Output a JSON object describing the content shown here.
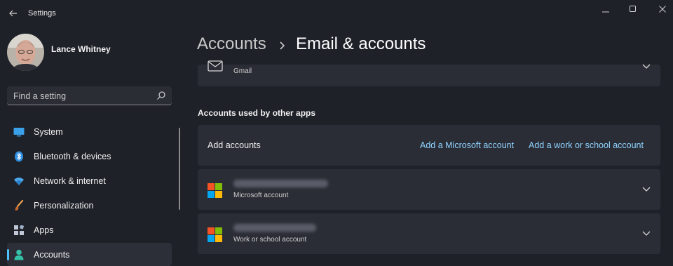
{
  "window": {
    "title": "Settings"
  },
  "user": {
    "name": "Lance Whitney"
  },
  "search": {
    "placeholder": "Find a setting"
  },
  "sidebar": {
    "items": [
      {
        "label": "System",
        "icon": "system-icon",
        "active": false
      },
      {
        "label": "Bluetooth & devices",
        "icon": "bluetooth-icon",
        "active": false
      },
      {
        "label": "Network & internet",
        "icon": "wifi-icon",
        "active": false
      },
      {
        "label": "Personalization",
        "icon": "paintbrush-icon",
        "active": false
      },
      {
        "label": "Apps",
        "icon": "apps-icon",
        "active": false
      },
      {
        "label": "Accounts",
        "icon": "accounts-icon",
        "active": true
      }
    ]
  },
  "header": {
    "parent": "Accounts",
    "separator": "›",
    "title": "Email & accounts"
  },
  "email_card": {
    "subtitle": "Gmail"
  },
  "section": {
    "other_apps_header": "Accounts used by other apps"
  },
  "add_accounts": {
    "label": "Add accounts",
    "add_microsoft": "Add a Microsoft account",
    "add_work_school": "Add a work or school account"
  },
  "accounts": [
    {
      "type": "Microsoft account",
      "email_blurred": true
    },
    {
      "type": "Work or school account",
      "email_blurred": true
    }
  ],
  "colors": {
    "background": "#1f2129",
    "card": "#2b2d36",
    "accent": "#4cc2ff",
    "link": "#8fd3ff"
  }
}
